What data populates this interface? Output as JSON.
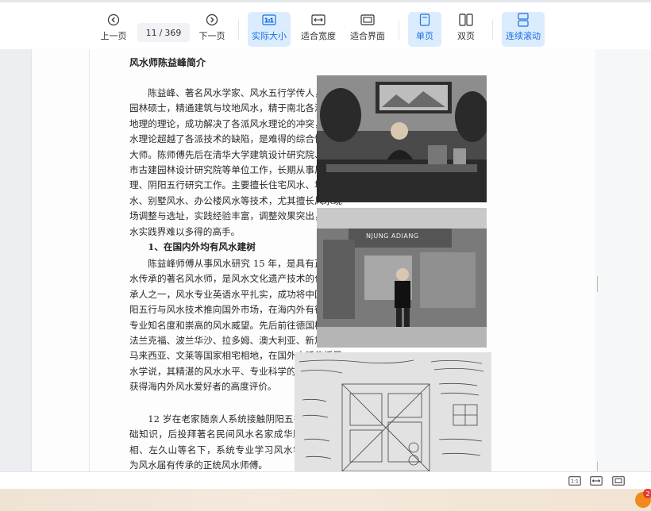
{
  "toolbar": {
    "prev_label": "上一页",
    "next_label": "下一页",
    "current_page": "11",
    "page_separator": "/",
    "total_pages": "369",
    "actual_size_label": "实际大小",
    "fit_width_label": "适合宽度",
    "fit_page_label": "适合界面",
    "single_page_label": "单页",
    "double_page_label": "双页",
    "continuous_label": "连续滚动"
  },
  "document": {
    "heading": "风水师陈益峰简介",
    "paragraph1": "陈益峰、著名风水学家、风水五行学传人，风景园林硕士，精通建筑与坟地风水，精于南北各派风水地理的理论，成功解决了各派风水理论的冲突，其风水理论超越了各派技术的缺陷，是难得的综合性风水大师。陈师傅先后在清华大学建筑设计研究院、北京市古建园林设计研究院等单位工作，长期从事风水地理、阴阳五行研究工作。主要擅长住宅风水、坟地风水、别墅风水、办公楼风水等技术，尤其擅长风水现场调整与选址，实践经验丰富，调整效果突出，是风水实践界难以多得的高手。",
    "section1_title": "1、在国内外均有风水建树",
    "paragraph2": "陈益峰师傅从事风水研究 15 年，是具有正统风水传承的著名风水师，是风水文化遗产技术的代表传承人之一，风水专业英语水平扎实，成功将中国的阴阳五行与风水技术推向国外市场，在海内外有很高的专业知名度和崇高的风水威望。先后前往德国柏林、法兰克福、波兰华沙、拉多姆、澳大利亚、新加坡、马来西亚、文莱等国家相宅相地，在国外广泛传播风水学说，其精湛的风水水平、专业科学的风水精神，获得海内外风水爱好者的高度评价。",
    "paragraph3": "12 岁在老家随亲人系统接触阴阳五行的基础知识，后投拜著名民间风水名家成华顺、陈相、左久山等名下，系统专业学习风水学说，为风水届有传承的正统风水师傅。",
    "photo2_sign": "NJUNG ADIANG"
  },
  "statusbar": {
    "icons": [
      "actual-size-icon",
      "fit-width-icon",
      "fit-page-icon"
    ]
  },
  "taskbar": {
    "badge": "2"
  },
  "colors": {
    "accent": "#1a6fe0",
    "active_bg": "#dcecff",
    "page_bg": "#fdfdfd",
    "viewer_bg": "#eceef1"
  }
}
